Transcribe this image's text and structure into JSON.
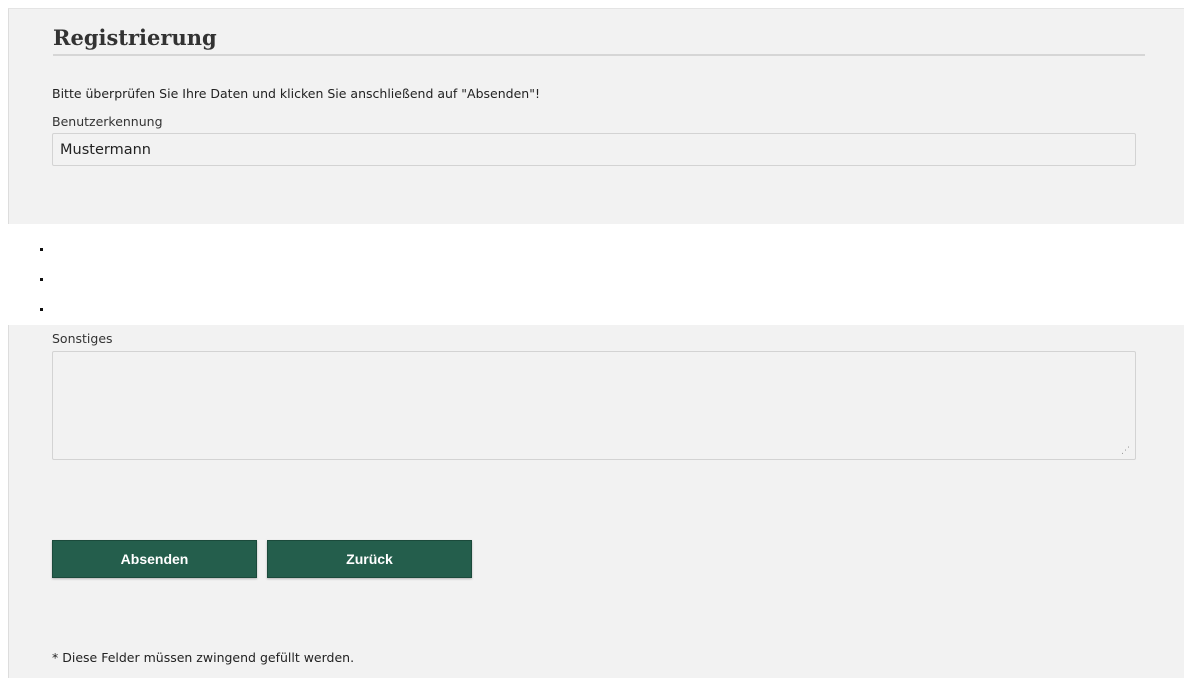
{
  "form": {
    "title": "Registrierung",
    "intro": "Bitte überprüfen Sie Ihre Daten und klicken Sie anschließend auf \"Absenden\"!",
    "username": {
      "label": "Benutzerkennung",
      "value": "Mustermann"
    },
    "misc": {
      "label": "Sonstiges",
      "value": ""
    },
    "submit_label": "Absenden",
    "back_label": "Zurück",
    "footnote": "* Diese Felder müssen zwingend gefüllt werden."
  },
  "colors": {
    "button_bg": "#245e4c",
    "panel_bg": "#f2f2f2"
  },
  "icons": {
    "resize_grip": "resize-grip-icon"
  }
}
